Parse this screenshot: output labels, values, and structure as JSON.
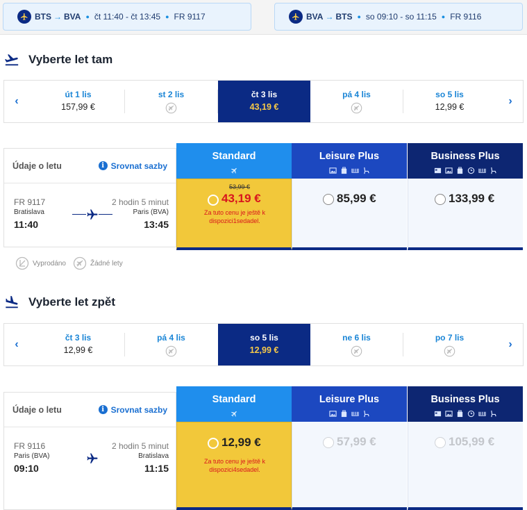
{
  "summary": {
    "outbound": {
      "from": "BTS",
      "to": "BVA",
      "date_time": "čt 11:40 - čt 13:45",
      "flight": "FR 9117"
    },
    "inbound": {
      "from": "BVA",
      "to": "BTS",
      "date_time": "so 09:10 - so 11:15",
      "flight": "FR 9116"
    },
    "arrow": "→",
    "dot": "●"
  },
  "outbound": {
    "title": "Vyberte let tam",
    "dates": [
      {
        "label": "út 1 lis",
        "price": "157,99 €"
      },
      {
        "label": "st 2 lis",
        "price": ""
      },
      {
        "label": "čt 3 lis",
        "price": "43,19 €"
      },
      {
        "label": "pá 4 lis",
        "price": ""
      },
      {
        "label": "so 5 lis",
        "price": "12,99 €"
      }
    ],
    "flight": {
      "header": "Údaje o letu",
      "compare": "Srovnat sazby",
      "number": "FR 9117",
      "duration": "2 hodin 5 minut",
      "from": "Bratislava",
      "to": "Paris (BVA)",
      "dep": "11:40",
      "arr": "13:45"
    },
    "fares": {
      "standard": {
        "name": "Standard",
        "old_price": "53,99 €",
        "price": "43,19 €",
        "note": "Za tuto cenu je ještě k dispozici1sedadel."
      },
      "leisure": {
        "name": "Leisure Plus",
        "price": "85,99 €"
      },
      "business": {
        "name": "Business Plus",
        "price": "133,99 €"
      }
    }
  },
  "legend": {
    "sold_out": "Vyprodáno",
    "no_flights": "Žádné lety"
  },
  "inbound": {
    "title": "Vyberte let zpět",
    "dates": [
      {
        "label": "čt 3 lis",
        "price": "12,99 €"
      },
      {
        "label": "pá 4 lis",
        "price": ""
      },
      {
        "label": "so 5 lis",
        "price": "12,99 €"
      },
      {
        "label": "ne 6 lis",
        "price": ""
      },
      {
        "label": "po 7 lis",
        "price": ""
      }
    ],
    "flight": {
      "header": "Údaje o letu",
      "compare": "Srovnat sazby",
      "number": "FR 9116",
      "duration": "2 hodin 5 minut",
      "from": "Paris (BVA)",
      "to": "Bratislava",
      "dep": "09:10",
      "arr": "11:15"
    },
    "fares": {
      "standard": {
        "name": "Standard",
        "price": "12,99 €",
        "note": "Za tuto cenu je ještě k dispozici4sedadel."
      },
      "leisure": {
        "name": "Leisure Plus",
        "price": "57,99 €"
      },
      "business": {
        "name": "Business Plus",
        "price": "105,99 €"
      }
    }
  },
  "nav": {
    "prev": "‹",
    "next": "›"
  },
  "colors": {
    "navy": "#0b2a84",
    "accent": "#1a85d6",
    "yellow": "#f2c83a",
    "red": "#d8151d"
  }
}
